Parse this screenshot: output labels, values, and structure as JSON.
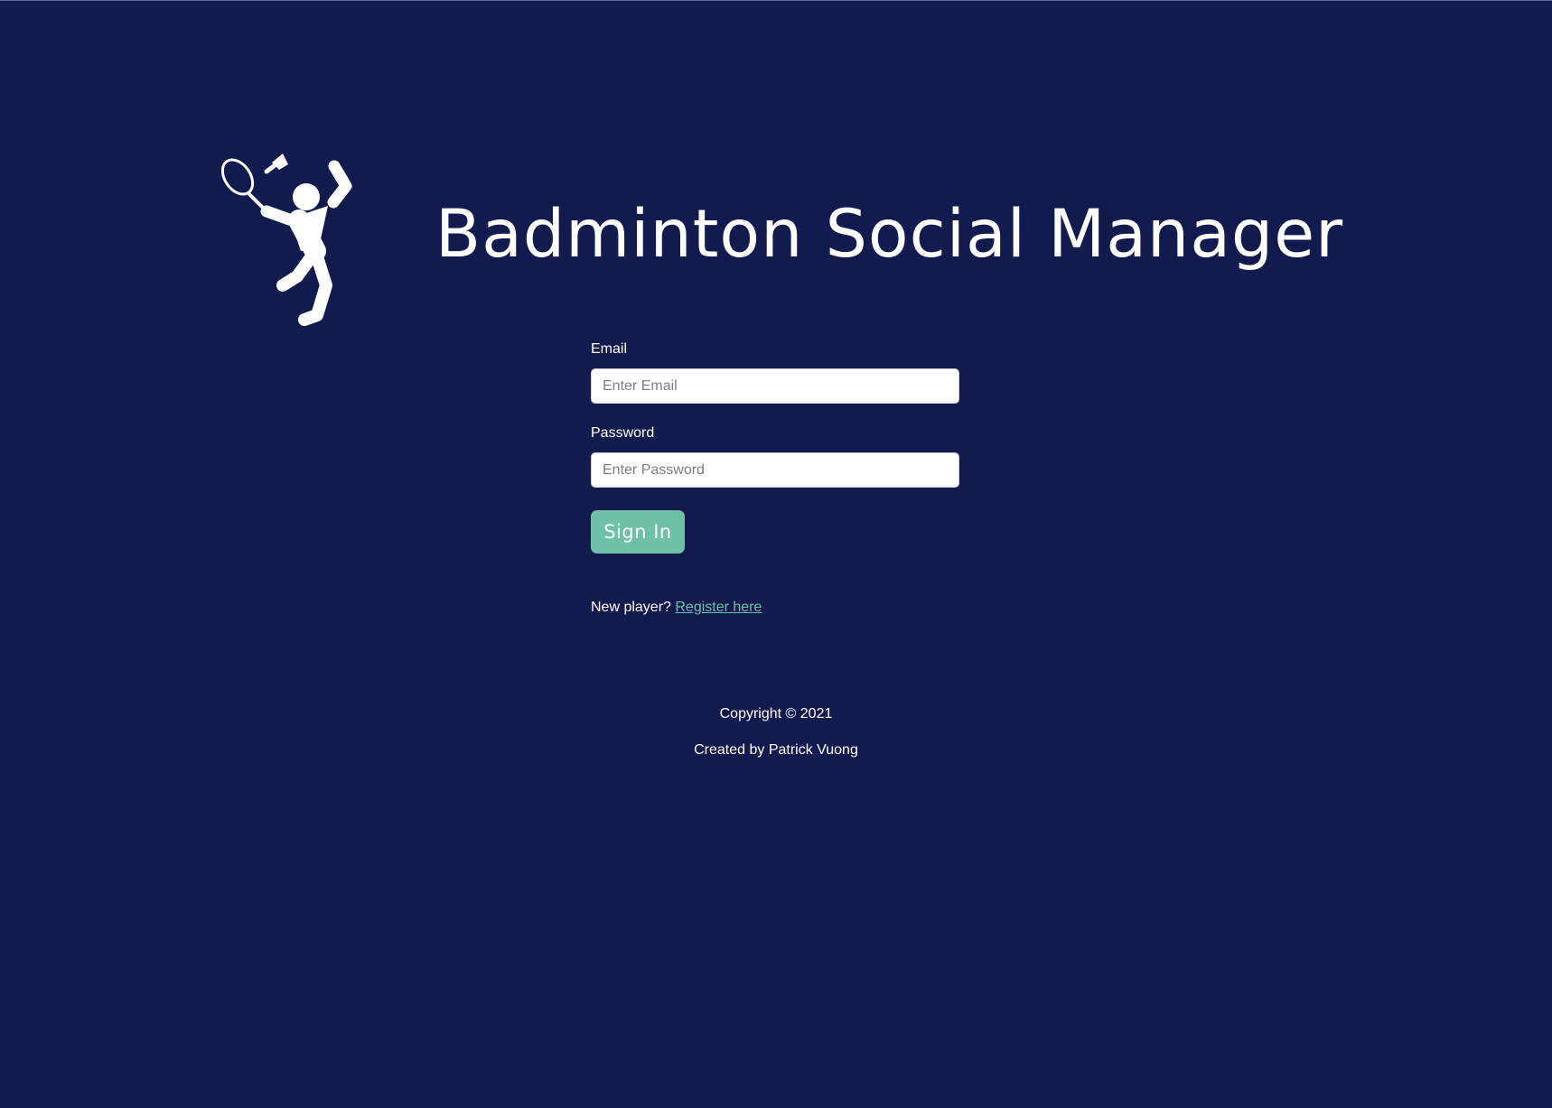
{
  "header": {
    "title": "Badminton Social Manager",
    "logo_icon": "badminton-player-icon"
  },
  "form": {
    "email_label": "Email",
    "email_placeholder": "Enter Email",
    "email_value": "",
    "password_label": "Password",
    "password_placeholder": "Enter Password",
    "password_value": "",
    "signin_label": "Sign In"
  },
  "register": {
    "prompt": "New player? ",
    "link_text": "Register here"
  },
  "footer": {
    "copyright": "Copyright © 2021",
    "credit": "Created by Patrick Vuong"
  },
  "colors": {
    "background": "#131b4e",
    "accent": "#6fc0a8",
    "text": "#ffffff"
  }
}
